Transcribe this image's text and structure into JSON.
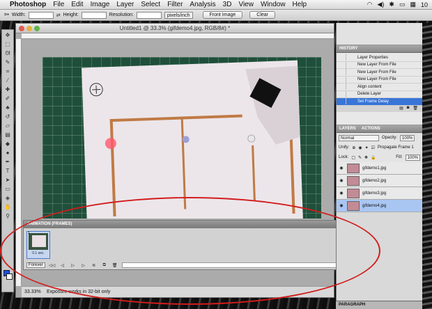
{
  "menubar": {
    "apple": "",
    "items": [
      "Photoshop",
      "File",
      "Edit",
      "Image",
      "Layer",
      "Select",
      "Filter",
      "Analysis",
      "3D",
      "View",
      "Window",
      "Help"
    ],
    "status_right": "10"
  },
  "options": {
    "width_label": "Width:",
    "height_label": "Height:",
    "resolution_label": "Resolution:",
    "units": "pixels/inch",
    "front_image": "Front Image",
    "clear": "Clear"
  },
  "document": {
    "title": "Untitled1 @ 33.3% (gifdemo4.jpg, RGB/8#) *",
    "zoom": "33.33%",
    "status": "Exposure works in 32-bit only"
  },
  "animation": {
    "header": "ANIMATION (FRAMES)",
    "frame_number": "1",
    "frame_delay": "0.1 sec.",
    "loop": "Forever"
  },
  "history": {
    "header": "HISTORY",
    "items": [
      "Layer Properties",
      "New Layer From File",
      "New Layer From File",
      "New Layer From File",
      "Align content",
      "Delete Layer",
      "Set Frame Delay"
    ],
    "selected_index": 6
  },
  "layers": {
    "tabs": [
      "LAYERS",
      "ACTIONS"
    ],
    "blend_mode": "Normal",
    "opacity_label": "Opacity:",
    "opacity": "100%",
    "unify_label": "Unify:",
    "propagate_label": "Propagate Frame 1",
    "lock_label": "Lock:",
    "fill_label": "Fill:",
    "fill": "100%",
    "items": [
      {
        "name": "gifdemo1.jpg",
        "selected": false
      },
      {
        "name": "gifdemo2.jpg",
        "selected": false
      },
      {
        "name": "gifdemo3.jpg",
        "selected": false
      },
      {
        "name": "gifdemo4.jpg",
        "selected": true
      }
    ]
  },
  "paragraph": {
    "header": "PARAGRAPH"
  },
  "colors": {
    "accent": "#3875d7",
    "annotation": "#d21c1c"
  }
}
